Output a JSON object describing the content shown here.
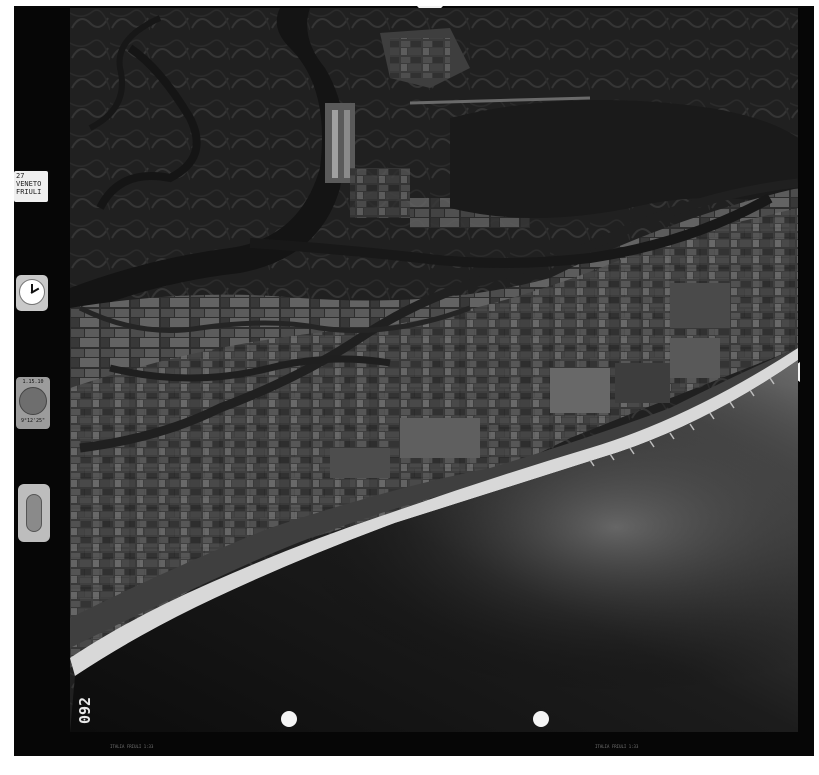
{
  "image": {
    "label_card": {
      "line1": "27",
      "line2": "VENETO",
      "line3": "FRIULI"
    },
    "altimeter": {
      "top_text": "1.15.10",
      "bottom_text": "9°12'25\""
    },
    "frame_number": "092",
    "footer_text_left": "ITALIA FRIULI 1:33",
    "footer_text_right": "ITALIA FRIULI 1:33"
  }
}
